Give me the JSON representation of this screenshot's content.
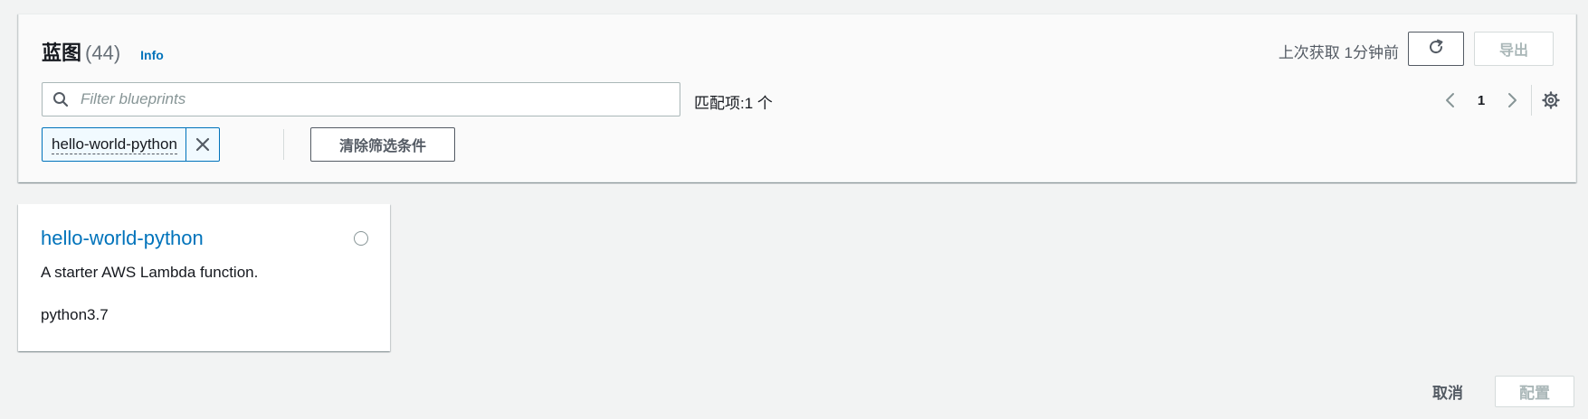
{
  "header": {
    "title": "蓝图",
    "count": "(44)",
    "info_label": "Info",
    "last_fetched": "上次获取 1分钟前",
    "export_label": "导出"
  },
  "filter": {
    "placeholder": "Filter blueprints",
    "value": "",
    "match_count": "匹配项:1 个",
    "token_label": "hello-world-python",
    "clear_label": "清除筛选条件"
  },
  "pagination": {
    "current_page": "1"
  },
  "blueprints": [
    {
      "title": "hello-world-python",
      "description": "A starter AWS Lambda function.",
      "runtime": "python3.7",
      "selected": false
    }
  ],
  "footer": {
    "cancel_label": "取消",
    "configure_label": "配置"
  },
  "icons": {
    "search": "search-icon",
    "refresh": "refresh-icon",
    "prev": "chevron-left-icon",
    "next": "chevron-right-icon",
    "settings": "gear-icon",
    "close": "close-icon"
  },
  "colors": {
    "link": "#0073bb",
    "token_bg": "#f1faff",
    "disabled_text": "#aab7b8",
    "page_bg": "#f2f3f3"
  }
}
